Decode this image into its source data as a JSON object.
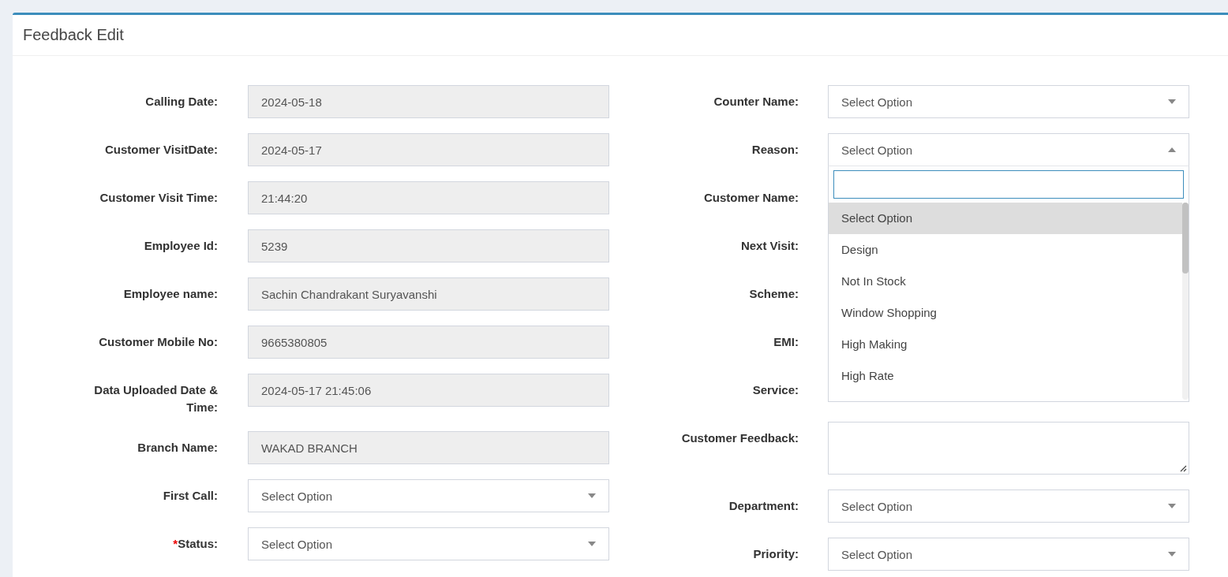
{
  "page": {
    "title": "Feedback Edit"
  },
  "left_fields": [
    {
      "label": "Calling Date:",
      "kind": "readonly",
      "value": "2024-05-18"
    },
    {
      "label": "Customer VisitDate:",
      "kind": "readonly",
      "value": "2024-05-17"
    },
    {
      "label": "Customer Visit Time:",
      "kind": "readonly",
      "value": "21:44:20"
    },
    {
      "label": "Employee Id:",
      "kind": "readonly",
      "value": "5239"
    },
    {
      "label": "Employee name:",
      "kind": "readonly",
      "value": "Sachin Chandrakant Suryavanshi"
    },
    {
      "label": "Customer Mobile No:",
      "kind": "readonly",
      "value": "9665380805"
    },
    {
      "label": "Data Uploaded Date & Time:",
      "kind": "readonly",
      "value": "2024-05-17 21:45:06"
    },
    {
      "label": "Branch Name:",
      "kind": "readonly",
      "value": "WAKAD BRANCH"
    },
    {
      "label": "First Call:",
      "kind": "select",
      "value": "Select Option",
      "expanded": false
    },
    {
      "label": "Status:",
      "required_mark": "*",
      "kind": "select",
      "value": "Select Option",
      "expanded": false
    }
  ],
  "right_fields": [
    {
      "label": "Counter Name:",
      "kind": "select",
      "value": "Select Option",
      "expanded": false
    },
    {
      "label": "Reason:",
      "kind": "select",
      "value": "Select Option",
      "expanded": true
    },
    {
      "label": "Customer Name:",
      "kind": "covered"
    },
    {
      "label": "Next Visit:",
      "kind": "covered"
    },
    {
      "label": "Scheme:",
      "kind": "covered"
    },
    {
      "label": "EMI:",
      "kind": "covered"
    },
    {
      "label": "Service:",
      "kind": "covered"
    },
    {
      "label": "Customer Feedback:",
      "kind": "textarea"
    },
    {
      "label": "Department:",
      "kind": "select",
      "value": "Select Option",
      "expanded": false
    },
    {
      "label": "Priority:",
      "kind": "select",
      "value": "Select Option",
      "expanded": false
    }
  ],
  "reason_dropdown": {
    "options": [
      {
        "label": "Select Option",
        "selected": true
      },
      {
        "label": "Design",
        "selected": false
      },
      {
        "label": "Not In Stock",
        "selected": false
      },
      {
        "label": "Window Shopping",
        "selected": false
      },
      {
        "label": "High Making",
        "selected": false
      },
      {
        "label": "High Rate",
        "selected": false
      }
    ]
  }
}
